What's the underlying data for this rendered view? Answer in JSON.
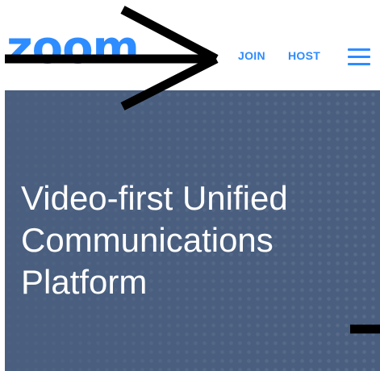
{
  "header": {
    "logo_text": "zoom",
    "nav": {
      "join_label": "JOIN",
      "host_label": "HOST"
    },
    "menu_icon": "hamburger-menu-icon"
  },
  "hero": {
    "headline": "Video-first Unified\nCommunications\nPlatform"
  },
  "colors": {
    "brand_blue": "#2d8cff",
    "hero_background": "#4a5f7f",
    "annotation_black": "#000000"
  }
}
